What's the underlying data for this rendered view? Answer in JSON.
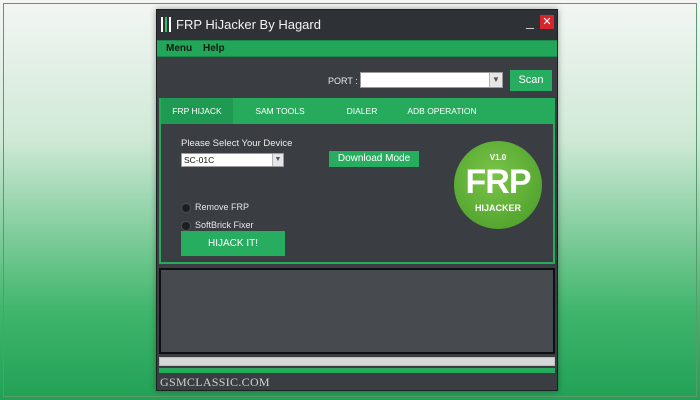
{
  "window": {
    "title": "FRP HiJacker By Hagard",
    "close_symbol": "✕",
    "minimize_symbol": "_",
    "app_icon": "grip-bars-icon"
  },
  "menu": {
    "items": [
      {
        "label": "Menu"
      },
      {
        "label": "Help"
      }
    ]
  },
  "port": {
    "label": "PORT :",
    "value": "",
    "scan_label": "Scan"
  },
  "tabs": [
    {
      "label": "FRP HIJACK",
      "active": true
    },
    {
      "label": "SAM TOOLS",
      "active": false
    },
    {
      "label": "DIALER",
      "active": false
    },
    {
      "label": "ADB OPERATION",
      "active": false
    }
  ],
  "panel": {
    "device_label": "Please Select Your Device",
    "device_value": "SC-01C",
    "download_mode_label": "Download Mode",
    "options": [
      {
        "label": "Remove FRP",
        "selected": false
      },
      {
        "label": "SoftBrick Fixer",
        "selected": false
      }
    ],
    "hijack_label": "HIJACK IT!"
  },
  "logo": {
    "version": "V1.0",
    "main": "FRP",
    "sub": "HIJACKER"
  },
  "log": {
    "text": ""
  },
  "progress": {
    "value": 0
  },
  "watermark": "GSMCLASSIC.COM",
  "colors": {
    "accent": "#26ad5f",
    "window_bg": "#3a3e42",
    "close": "#d6262c"
  }
}
